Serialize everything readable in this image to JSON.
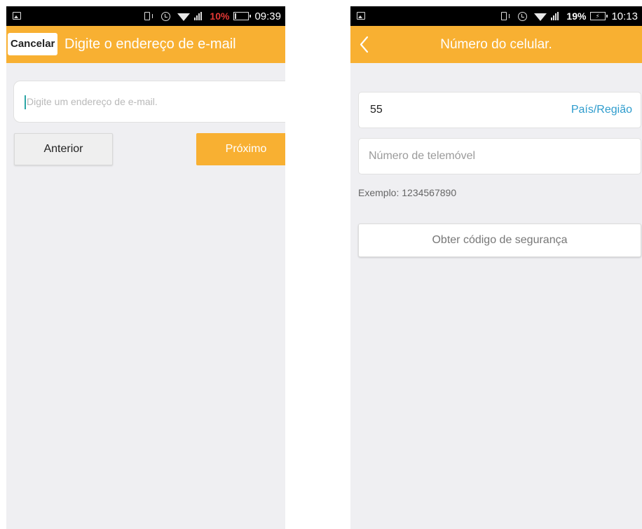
{
  "screens": {
    "left": {
      "status_bar": {
        "battery_percent": "10%",
        "battery_level": 0.1,
        "time": "09:39"
      },
      "header": {
        "cancel_label": "Cancelar",
        "title": "Digite o endereço de e-mail"
      },
      "email_input": {
        "placeholder": "Digite um endereço de e-mail.",
        "value": ""
      },
      "buttons": {
        "previous_label": "Anterior",
        "next_label": "Próximo"
      }
    },
    "right": {
      "status_bar": {
        "battery_percent": "19%",
        "battery_level": 0.19,
        "charging": true,
        "time": "10:13"
      },
      "header": {
        "title": "Número do celular."
      },
      "country_code": "55",
      "country_link_label": "País/Região",
      "phone_input": {
        "placeholder": "Número de telemóvel",
        "value": ""
      },
      "example_text": "Exemplo: 1234567890",
      "security_button_label": "Obter código de segurança"
    }
  },
  "colors": {
    "accent": "#f8b032",
    "link": "#2e9ccd",
    "battery_low": "#e53935",
    "background": "#efeff2",
    "status_bar": "#000000"
  }
}
